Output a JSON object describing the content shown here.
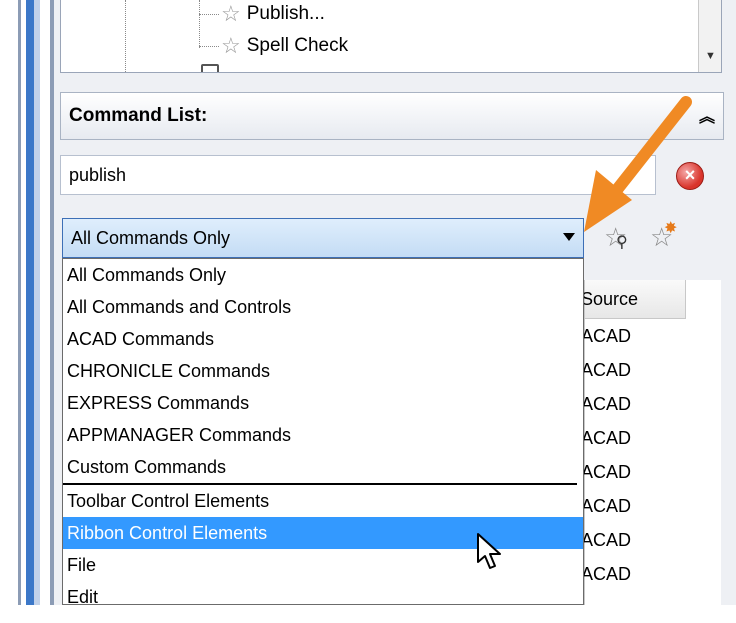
{
  "tree": {
    "items": [
      {
        "label": "Publish..."
      },
      {
        "label": "Spell Check"
      }
    ]
  },
  "command_list": {
    "title": "Command List:",
    "search_value": "publish",
    "filter_selected": "All Commands Only",
    "filter_options": [
      "All Commands Only",
      "All Commands and Controls",
      "ACAD Commands",
      "CHRONICLE Commands",
      "EXPRESS Commands",
      "APPMANAGER Commands",
      "Custom Commands",
      "Toolbar Control Elements",
      "Ribbon Control Elements",
      "File",
      "Edit"
    ],
    "highlighted_option": "Ribbon Control Elements",
    "table": {
      "source_header": "Source",
      "rows": [
        "ACAD",
        "ACAD",
        "ACAD",
        "ACAD",
        "ACAD",
        "ACAD",
        "ACAD",
        "ACAD"
      ]
    }
  },
  "colors": {
    "annotation_arrow": "#f08a24",
    "selection": "#3399ff"
  }
}
